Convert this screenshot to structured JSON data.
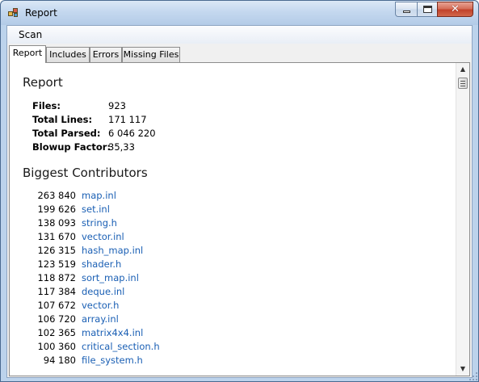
{
  "window": {
    "title": "Report"
  },
  "menu": {
    "items": [
      "Scan"
    ]
  },
  "tabs": [
    "Report",
    "Includes",
    "Errors",
    "Missing Files"
  ],
  "report": {
    "title": "Report",
    "stats": [
      {
        "label": "Files:",
        "value": "923"
      },
      {
        "label": "Total Lines:",
        "value": "171 117"
      },
      {
        "label": "Total Parsed:",
        "value": "6 046 220"
      },
      {
        "label": "Blowup Factor:",
        "value": "35,33"
      }
    ],
    "contributors_title": "Biggest Contributors",
    "contributors": [
      {
        "count": "263 840",
        "file": "map.inl"
      },
      {
        "count": "199 626",
        "file": "set.inl"
      },
      {
        "count": "138 093",
        "file": "string.h"
      },
      {
        "count": "131 670",
        "file": "vector.inl"
      },
      {
        "count": "126 315",
        "file": "hash_map.inl"
      },
      {
        "count": "123 519",
        "file": "shader.h"
      },
      {
        "count": "118 872",
        "file": "sort_map.inl"
      },
      {
        "count": "117 384",
        "file": "deque.inl"
      },
      {
        "count": "107 672",
        "file": "vector.h"
      },
      {
        "count": "106 720",
        "file": "array.inl"
      },
      {
        "count": "102 365",
        "file": "matrix4x4.inl"
      },
      {
        "count": "100 360",
        "file": "critical_section.h"
      },
      {
        "count": "94 180",
        "file": "file_system.h"
      }
    ]
  },
  "colors": {
    "link": "#1a5fb4",
    "titlebar": "#c4d8ef",
    "close_button": "#c2412a"
  },
  "icons": {
    "app": "app-icon",
    "minimize": "minimize-icon",
    "maximize": "maximize-icon",
    "close": "close-icon"
  }
}
